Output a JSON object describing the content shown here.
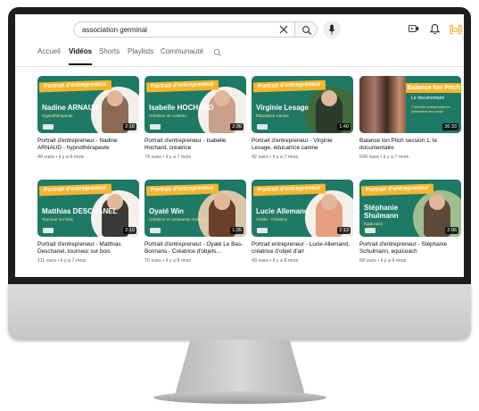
{
  "search": {
    "query": "association germinal"
  },
  "channel": {
    "avatar_text": "ᥫᩣᥫ"
  },
  "tabs": [
    {
      "label": "Accueil",
      "active": false
    },
    {
      "label": "Vidéos",
      "active": true
    },
    {
      "label": "Shorts",
      "active": false
    },
    {
      "label": "Playlists",
      "active": false
    },
    {
      "label": "Communauté",
      "active": false
    }
  ],
  "colors": {
    "thumb_green": "#1f7a65",
    "ribbon_yellow": "#f7b52b"
  },
  "videos": [
    {
      "ribbon": "Portrait d'entrepreneur",
      "name": "Nadine ARNAUD",
      "role": "Hypnothérapeute",
      "duration": "2:18",
      "title": "Portrait d'entrepreneur - Nadine ARNAUD - hypnothérapeute",
      "views": "40 vues",
      "age": "il y a 6 mois"
    },
    {
      "ribbon": "Portrait d'entrepreneur",
      "name": "Isabelle HOCHARD",
      "role": "Créatrice de contenu",
      "duration": "2:36",
      "title": "Portrait d'entrepreneur - Isabelle Hochard, créatrice",
      "views": "74 vues",
      "age": "il y a 7 mois"
    },
    {
      "ribbon": "Portrait d'entrepreneur",
      "name": "Virginie Lesage",
      "role": "Éducatrice Canine",
      "duration": "1:40",
      "title": "Portrait d'entrepreneur - Virginie Lesage, éducatrice canine",
      "views": "42 vues",
      "age": "il y a 7 mois"
    },
    {
      "pitch": true,
      "ribbon": "Balance ton Pitch",
      "doc": "Le documentaire",
      "detail": "7 femmes entrepreneures présentent leur projet",
      "duration": "36:33",
      "title": "Balance ton Pitch session 1, le documentaire",
      "views": "649 vues",
      "age": "il y a 7 mois"
    },
    {
      "ribbon": "Portrait d'entrepreneur",
      "name": "Matthias DESCHANEL",
      "role": "Tourneur sur bois",
      "duration": "2:10",
      "title": "Portrait d'entrepreneur - Matthias Deschanel, tourneur sur bois",
      "views": "111 vues",
      "age": "il y a 7 mois"
    },
    {
      "ribbon": "Portrait d'entrepreneur",
      "name": "Oyaté Win",
      "role": "Créatrice et community manager",
      "duration": "1:35",
      "title": "Portrait d'entrepreneur - Oyaté Le Bas-Bonnans - Créatrice d'objets...",
      "views": "70 vues",
      "age": "il y a 8 mois"
    },
    {
      "ribbon": "Portrait d'entrepreneur",
      "name": "Lucie Allemand",
      "role": "Artiste - Créatrice",
      "duration": "2:13",
      "title": "Portrait entrepreneur - Lucie Allemand, créatrice d'objet d'art",
      "views": "49 vues",
      "age": "il y a 8 mois"
    },
    {
      "ribbon": "Portrait d'entrepreneur",
      "name": "Stéphanie Shulmann",
      "role": "Equicoach",
      "duration": "2:06",
      "title": "Portrait d'entrepreneur - Stéphanie Schulmann, equicoach",
      "views": "58 vues",
      "age": "il y a 9 mois"
    }
  ]
}
